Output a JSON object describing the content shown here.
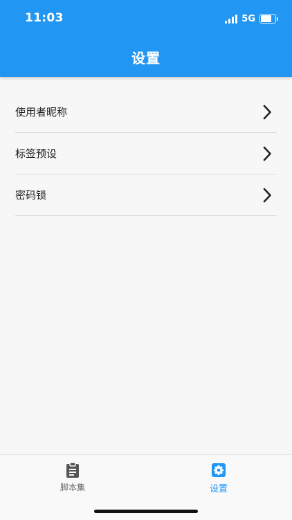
{
  "status_bar": {
    "time": "11:03",
    "network": "5G",
    "battery_level": 0.75
  },
  "header": {
    "title": "设置"
  },
  "settings": {
    "items": [
      {
        "label": "使用者昵称"
      },
      {
        "label": "标签预设"
      },
      {
        "label": "密码锁"
      }
    ]
  },
  "bottom_nav": {
    "tabs": [
      {
        "label": "脚本集",
        "icon": "clipboard-icon",
        "active": false
      },
      {
        "label": "设置",
        "icon": "gear-icon",
        "active": true
      }
    ]
  },
  "colors": {
    "primary": "#2196f3",
    "background": "#f7f7f7",
    "divider": "#d9d9d9",
    "inactive": "#666666"
  }
}
